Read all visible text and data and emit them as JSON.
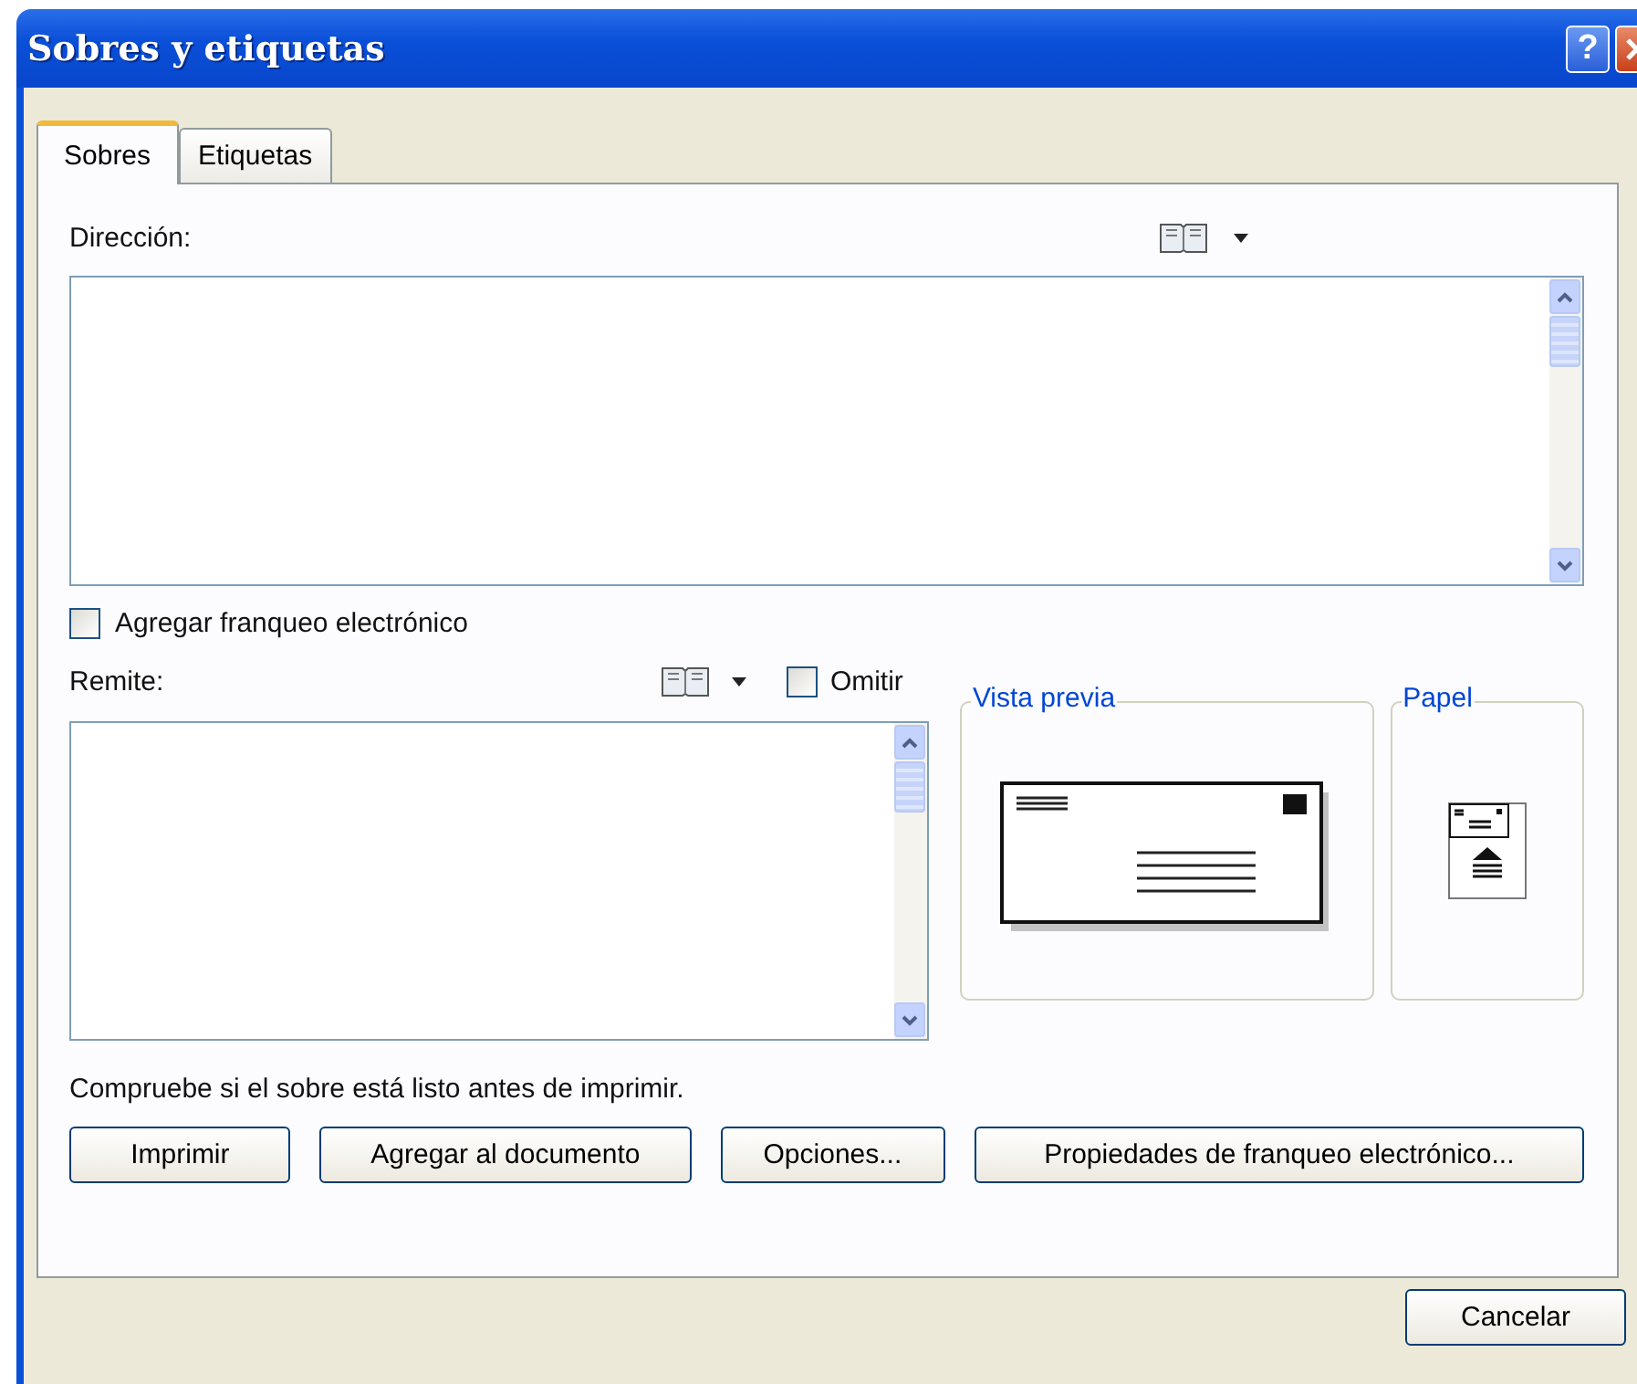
{
  "window": {
    "title": "Sobres y etiquetas",
    "help": "?"
  },
  "tabs": [
    {
      "label": "Sobres",
      "selected": true
    },
    {
      "label": "Etiquetas",
      "selected": false
    }
  ],
  "address": {
    "label": "Dirección:"
  },
  "electronic_postage": {
    "label": "Agregar franqueo electrónico",
    "checked": false
  },
  "return_address": {
    "label": "Remite:",
    "omit": {
      "label": "Omitir",
      "checked": false
    }
  },
  "preview": {
    "title": "Vista previa"
  },
  "paper": {
    "title": "Papel"
  },
  "note": "Compruebe si el sobre está listo antes de imprimir.",
  "buttons": [
    "Imprimir",
    "Agregar al documento",
    "Opciones...",
    "Propiedades de franqueo electrónico..."
  ],
  "footer_buttons": [
    "Cancelar"
  ]
}
